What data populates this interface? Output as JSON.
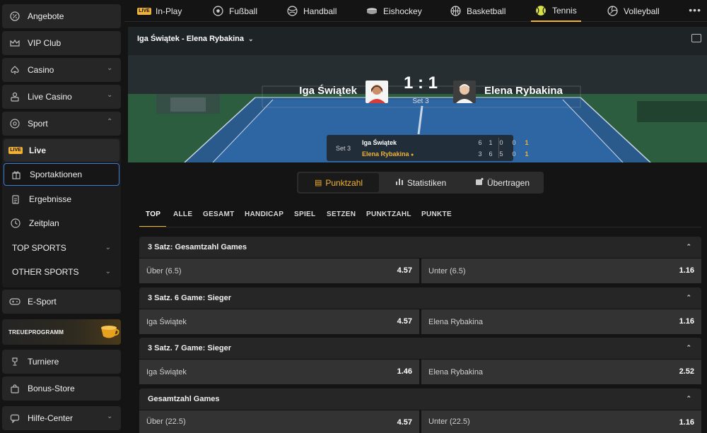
{
  "sidebar": {
    "items": [
      {
        "label": "Angebote",
        "icon": "percent-icon"
      },
      {
        "label": "VIP Club",
        "icon": "crown-icon"
      },
      {
        "label": "Casino",
        "icon": "spade-icon"
      },
      {
        "label": "Live Casino",
        "icon": "dealer-icon"
      },
      {
        "label": "Sport",
        "icon": "soccer-ball-icon"
      }
    ],
    "sport_sub": {
      "live_badge": "LIVE",
      "live": "Live",
      "sportaktionen": "Sportaktionen",
      "ergebnisse": "Ergebnisse",
      "zeitplan": "Zeitplan",
      "top_sports": "TOP SPORTS",
      "other_sports": "OTHER SPORTS"
    },
    "esport": "E-Sport",
    "treueprogramm": "TREUEPROGRAMM",
    "turniere": "Turniere",
    "bonus_store": "Bonus-Store",
    "hilfe_center": "Hilfe-Center"
  },
  "topnav": {
    "live_badge": "LIVE",
    "items": [
      "In-Play",
      "Fußball",
      "Handball",
      "Eishockey",
      "Basketball",
      "Tennis",
      "Volleyball"
    ],
    "active": "Tennis",
    "more": "•••"
  },
  "match": {
    "title": "Iga Świątek - Elena Rybakina",
    "player1": "Iga Świątek",
    "player2": "Elena Rybakina",
    "score": "1 : 1",
    "set_label": "Set 3",
    "scoreboard": {
      "set": "Set 3",
      "rows": [
        {
          "name": "Iga Świątek",
          "games": [
            "6",
            "1",
            "0",
            "0"
          ],
          "sets": "1"
        },
        {
          "name": "Elena Rybakina",
          "games": [
            "3",
            "6",
            "5",
            "0"
          ],
          "sets": "1",
          "serving": true
        }
      ]
    }
  },
  "view_tabs": [
    {
      "label": "Punktzahl",
      "active": true
    },
    {
      "label": "Statistiken",
      "active": false
    },
    {
      "label": "Übertragen",
      "active": false
    }
  ],
  "market_tabs": [
    "TOP",
    "ALLE",
    "GESAMT",
    "HANDICAP",
    "SPIEL",
    "SETZEN",
    "PUNKTZAHL",
    "PUNKTE"
  ],
  "markets": [
    {
      "title": "3 Satz: Gesamtzahl Games",
      "left": {
        "label": "Über (6.5)",
        "price": "4.57"
      },
      "right": {
        "label": "Unter (6.5)",
        "price": "1.16"
      }
    },
    {
      "title": "3 Satz. 6 Game: Sieger",
      "left": {
        "label": "Iga Świątek",
        "price": "4.57"
      },
      "right": {
        "label": "Elena Rybakina",
        "price": "1.16"
      }
    },
    {
      "title": "3 Satz. 7 Game: Sieger",
      "left": {
        "label": "Iga Świątek",
        "price": "1.46"
      },
      "right": {
        "label": "Elena Rybakina",
        "price": "2.52"
      }
    },
    {
      "title": "Gesamtzahl Games",
      "left": {
        "label": "Über (22.5)",
        "price": "4.57"
      },
      "right": {
        "label": "Unter (22.5)",
        "price": "1.16"
      }
    }
  ],
  "colors": {
    "accent": "#f2b233",
    "background": "#141414",
    "panel": "#262626",
    "odd_cell": "#333333",
    "focus_border": "#3d7bd9"
  }
}
